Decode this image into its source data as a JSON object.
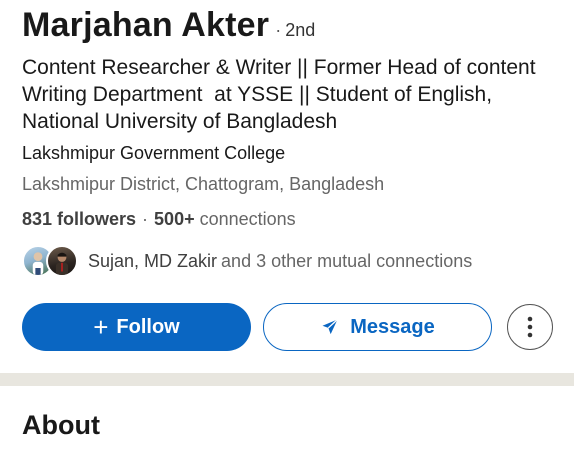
{
  "profile": {
    "name": "Marjahan Akter",
    "degree_separator": "·",
    "degree": "2nd",
    "headline": "Content Researcher & Writer || Former Head of content Writing Department  at YSSE || Student of English, National University of Bangladesh",
    "education": "Lakshmipur Government College",
    "location": "Lakshmipur District, Chattogram, Bangladesh"
  },
  "network": {
    "followers": "831 followers",
    "separator": "·",
    "connections_count": "500+",
    "connections_label": "connections"
  },
  "mutual": {
    "names": "Sujan, MD Zakir",
    "suffix": "and 3 other mutual connections"
  },
  "actions": {
    "follow_label": "Follow",
    "follow_icon": "plus-icon",
    "message_label": "Message",
    "message_icon": "send-icon",
    "more_icon": "more-vertical-icon"
  },
  "about": {
    "title": "About"
  },
  "colors": {
    "primary": "#0a66c2",
    "text": "#191919",
    "secondary_text": "#666666",
    "section_divider": "#e8e6df"
  }
}
